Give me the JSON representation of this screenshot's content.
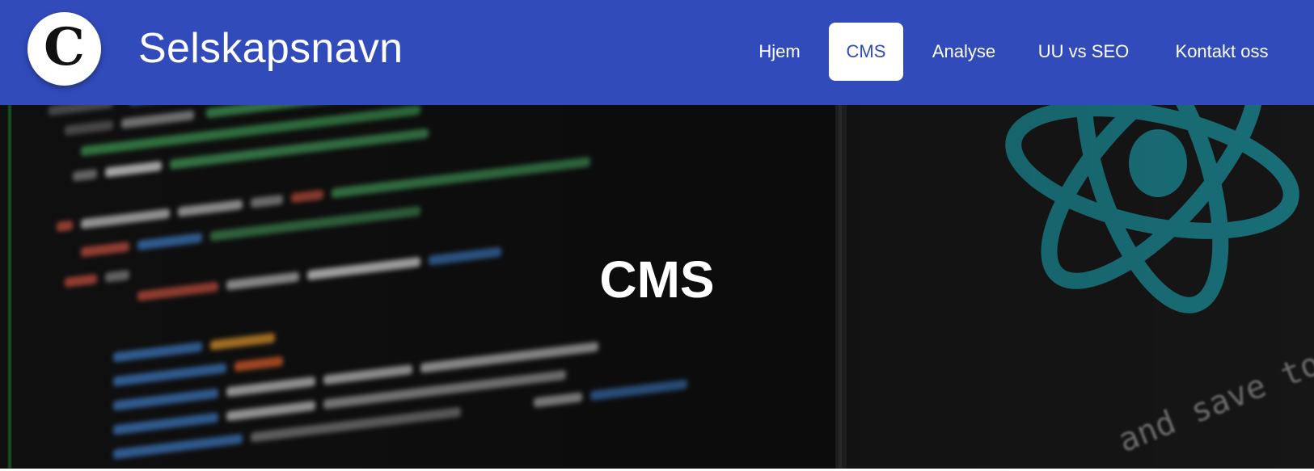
{
  "header": {
    "logo_letter": "C",
    "company_name": "Selskapsnavn",
    "nav": [
      {
        "label": "Hjem",
        "active": false
      },
      {
        "label": "CMS",
        "active": true
      },
      {
        "label": "Analyse",
        "active": false
      },
      {
        "label": "UU vs SEO",
        "active": false
      },
      {
        "label": "Kontakt oss",
        "active": false
      }
    ]
  },
  "hero": {
    "title": "CMS",
    "background_text": "and save to rel",
    "background_icon": "react-atom-icon"
  },
  "colors": {
    "header_bg": "#314bbb",
    "active_nav_bg": "#ffffff",
    "active_nav_text": "#314bbb",
    "react_logo": "#1f8a95"
  }
}
